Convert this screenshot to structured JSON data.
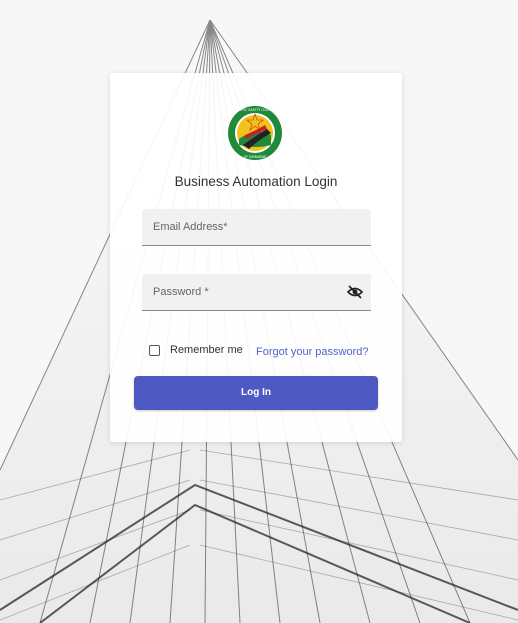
{
  "background": {
    "description_icon": "building-facade-background"
  },
  "login": {
    "logo_icon": "traffic-safety-council-logo",
    "logo_text_top": "TRAFFIC SAFETY COUNCIL",
    "logo_text_bottom": "OF ZIMBABWE",
    "title": "Business Automation Login",
    "email_label": "Email Address*",
    "password_label": "Password *",
    "password_toggle_icon": "eye-off-icon",
    "remember_label": "Remember me",
    "remember_checked": false,
    "forgot_label": "Forgot your password?",
    "login_label": "Log In"
  },
  "colors": {
    "accent": "#4e5ac2",
    "link": "#5562c9",
    "logo_green": "#1f8a3a",
    "logo_red": "#c8202a",
    "logo_yellow": "#f2c21b"
  }
}
